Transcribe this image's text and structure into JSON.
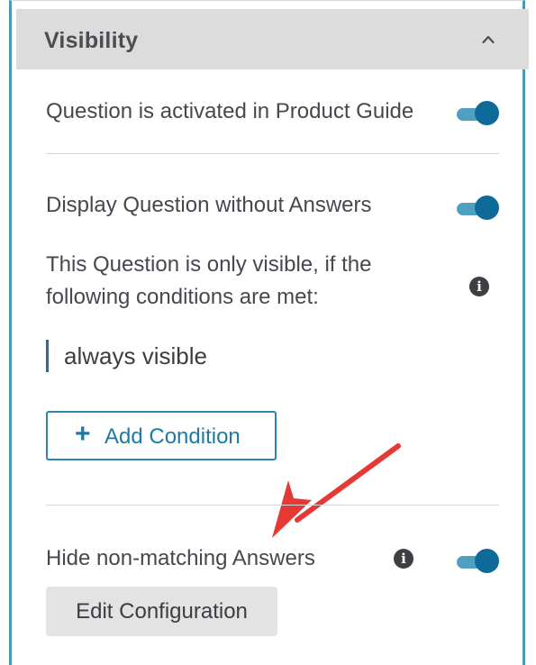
{
  "panel": {
    "title": "Visibility",
    "collapse_icon": "chevron-up-icon"
  },
  "settings": {
    "activated_label": "Question is activated in Product Guide",
    "activated_on": true,
    "display_without_answers_label": "Display Question without Answers",
    "display_without_answers_on": true,
    "conditions_desc_line1": "This Question is only visible, if the",
    "conditions_desc_line2": "following conditions are met:",
    "condition_value": "always visible",
    "add_condition_label": "Add Condition",
    "add_condition_icon": "plus-icon",
    "hide_non_matching_label": "Hide non-matching Answers",
    "hide_non_matching_on": true,
    "edit_configuration_label": "Edit Configuration",
    "info_icon": "info-icon"
  },
  "annotation": {
    "arrow_color": "#e53935"
  },
  "colors": {
    "accent": "#0e6a99",
    "frame_border": "#4a9ab5",
    "header_bg": "#dcdcdc"
  }
}
